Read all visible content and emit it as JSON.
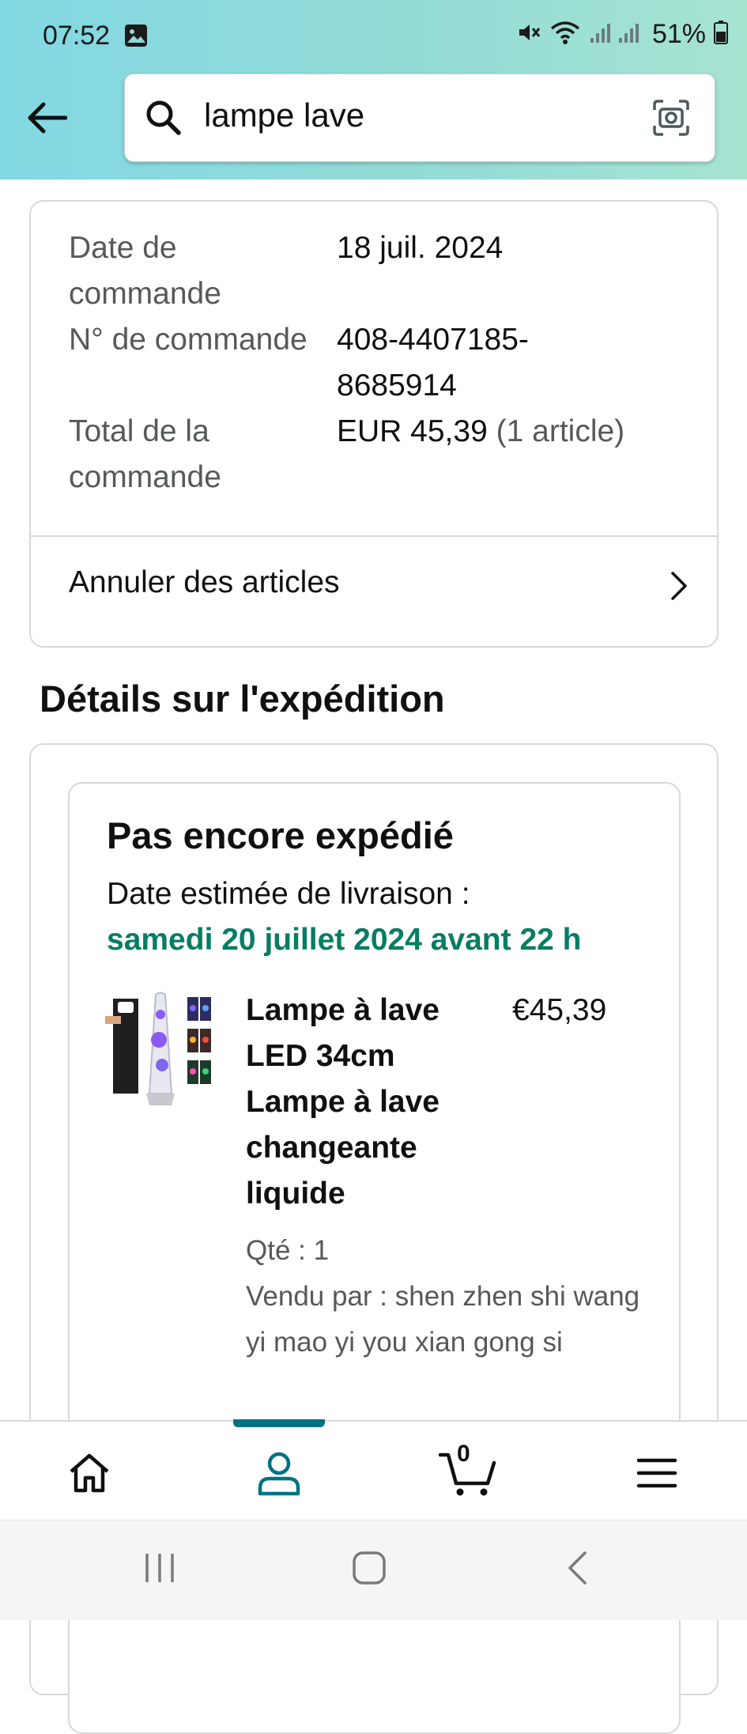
{
  "status_bar": {
    "time": "07:52",
    "battery": "51%",
    "icons": [
      "gallery-icon",
      "mute-icon",
      "wifi-icon",
      "signal-icon",
      "battery-icon"
    ]
  },
  "search": {
    "query": "lampe lave",
    "icons": [
      "back-arrow-icon",
      "search-icon",
      "camera-icon"
    ]
  },
  "order_summary": {
    "rows": [
      {
        "label": "Date de commande",
        "value": "18 juil. 2024"
      },
      {
        "label": "N° de commande",
        "value": "408-4407185-8685914"
      },
      {
        "label": "Total de la commande",
        "value_main": "EUR 45,39",
        "value_extra": "(1 article)"
      }
    ],
    "cancel_label": "Annuler des articles"
  },
  "shipment": {
    "section_title": "Détails sur l'expédition",
    "status": "Pas encore expédié",
    "estimate_label": "Date estimée de livraison :",
    "estimate_date": "samedi 20 juillet 2024 avant 22 h",
    "product": {
      "title": "Lampe à lave LED 34cm Lampe à lave changeante liquide",
      "price": "€45,39",
      "quantity": "Qté : 1",
      "seller": "Vendu par : shen zhen shi wang yi mao yi you xian gong si"
    }
  },
  "bottom_nav": {
    "items": [
      "home-icon",
      "account-icon",
      "cart-icon",
      "menu-icon"
    ],
    "active": "account-icon",
    "cart_count": "0",
    "accent_color": "#007185"
  },
  "colors": {
    "delivery_green": "#067d62",
    "secondary_text": "#565959"
  }
}
